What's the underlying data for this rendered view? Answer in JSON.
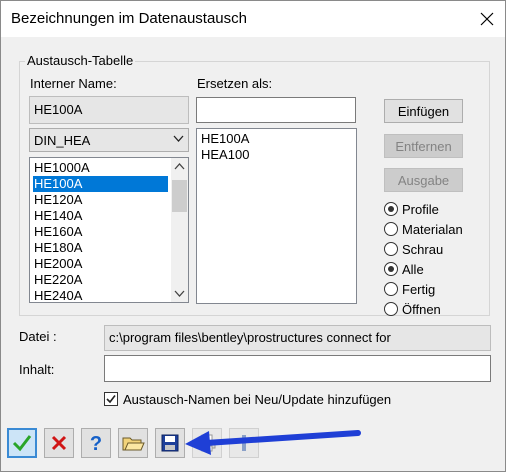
{
  "window": {
    "title": "Bezeichnungen im Datenaustausch"
  },
  "group": {
    "legend": "Austausch-Tabelle",
    "internal_label": "Interner Name:",
    "internal_value": "HE100A",
    "replace_label": "Ersetzen als:",
    "replace_value": "",
    "combo_value": "DIN_HEA",
    "internal_list": [
      "HE1000A",
      "HE100A",
      "HE120A",
      "HE140A",
      "HE160A",
      "HE180A",
      "HE200A",
      "HE220A",
      "HE240A"
    ],
    "selected_internal": "HE100A",
    "replace_list": [
      "HE100A",
      "HEA100"
    ]
  },
  "buttons": {
    "insert": "Einfügen",
    "remove": "Entfernen",
    "output": "Ausgabe"
  },
  "radios": [
    {
      "label": "Profile",
      "checked": true
    },
    {
      "label": "Materialan",
      "checked": false
    },
    {
      "label": "Schrau",
      "checked": false
    },
    {
      "label": "Alle",
      "checked": true
    },
    {
      "label": "Fertig",
      "checked": false
    },
    {
      "label": "Öffnen",
      "checked": false
    }
  ],
  "file": {
    "label": "Datei :",
    "path": "c:\\program files\\bentley\\prostructures connect for"
  },
  "content": {
    "label": "Inhalt:",
    "value": ""
  },
  "checkbox": {
    "label": "Austausch-Namen bei Neu/Update hinzufügen",
    "checked": true
  },
  "toolbar": [
    {
      "name": "ok-check-icon"
    },
    {
      "name": "cancel-x-icon"
    },
    {
      "name": "help-question-icon"
    },
    {
      "name": "open-folder-icon"
    },
    {
      "name": "save-floppy-icon"
    },
    {
      "name": "print-icon"
    },
    {
      "name": "info-icon"
    }
  ],
  "colors": {
    "accent": "#0078d7",
    "arrow": "#1f3fd6",
    "check": "#2aa52a",
    "xred": "#d01515"
  }
}
